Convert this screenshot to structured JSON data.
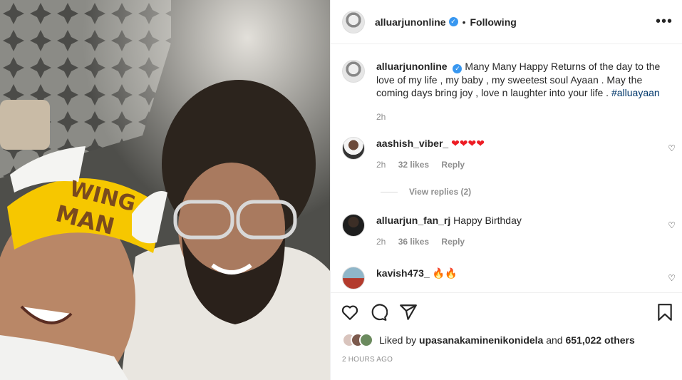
{
  "post": {
    "username": "alluarjunonline",
    "verified_mark": "✓",
    "dot": "•",
    "follow_status": "Following",
    "more": "•••",
    "headband_line1": "WING",
    "headband_line2": "MAN"
  },
  "caption": {
    "username": "alluarjunonline",
    "text": "Many Many Happy Returns of the day to the love of my life , my baby , my sweetest soul Ayaan . May the coming days bring joy , love n laughter into your life . ",
    "hashtag": "#alluayaan",
    "time": "2h"
  },
  "comments": [
    {
      "username": "aashish_viber_",
      "text": "❤❤❤❤",
      "time": "2h",
      "likes": "32 likes",
      "reply": "Reply",
      "view_replies": "View replies (2)"
    },
    {
      "username": "alluarjun_fan_rj",
      "text": "Happy Birthday",
      "time": "2h",
      "likes": "36 likes",
      "reply": "Reply"
    },
    {
      "username": "kavish473_",
      "text": "🔥🔥"
    }
  ],
  "actions": {
    "liked_by_prefix": "Liked by",
    "liked_by_user": "upasanakaminenikonidela",
    "and": "and",
    "others": "651,022 others",
    "timestamp": "2 HOURS AGO"
  },
  "icons": [
    "heart-icon",
    "comment-icon",
    "share-icon",
    "bookmark-icon",
    "more-icon",
    "verified-icon"
  ],
  "colors": {
    "verified": "#3897f0",
    "hashtag": "#00376b",
    "muted": "#8e8e8e",
    "heart": "#ed1c24"
  }
}
